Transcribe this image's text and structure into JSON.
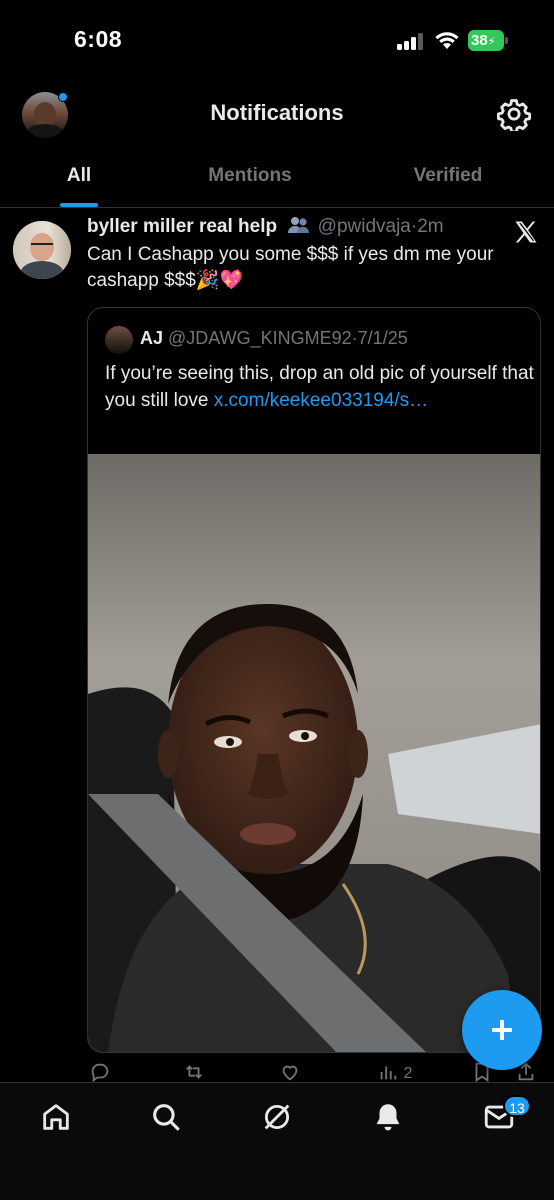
{
  "status_bar": {
    "time": "6:08",
    "battery_level": "38",
    "icons": [
      "signal-icon",
      "wifi-icon",
      "battery-icon"
    ]
  },
  "header": {
    "title": "Notifications",
    "settings_icon": "gear-icon"
  },
  "tabs": [
    {
      "label": "All",
      "active": true
    },
    {
      "label": "Mentions",
      "active": false
    },
    {
      "label": "Verified",
      "active": false
    }
  ],
  "tweet": {
    "display_name": "byller miller real help",
    "badge_icon": "people-icon",
    "handle": "@pwidvaja",
    "separator": "·",
    "time": "2m",
    "source_icon": "x-logo-icon",
    "text": "Can I Cashapp you some $$$ if yes dm me your cashapp $$$🎉💖",
    "quote": {
      "name": "AJ",
      "handle": "@JDAWG_KINGME92",
      "separator": "·",
      "date": "7/1/25",
      "text": "If you’re seeing this, drop an old pic of yourself that you still love ",
      "link_text": "x.com/keekee033194/s…"
    },
    "actions": {
      "reply_icon": "reply-icon",
      "retweet_icon": "retweet-icon",
      "like_icon": "heart-icon",
      "views_icon": "views-icon",
      "views_count": "2",
      "bookmark_icon": "bookmark-icon",
      "share_icon": "share-icon"
    }
  },
  "fab": {
    "icon": "plus-icon"
  },
  "bottom_nav": {
    "items": [
      "home-icon",
      "search-icon",
      "grok-icon",
      "notifications-icon",
      "messages-icon"
    ],
    "messages_badge": "13"
  },
  "colors": {
    "accent": "#1d9bf0",
    "background": "#000000",
    "text_primary": "#e7e9ea",
    "text_secondary": "#71767b",
    "border": "#2f3336"
  }
}
